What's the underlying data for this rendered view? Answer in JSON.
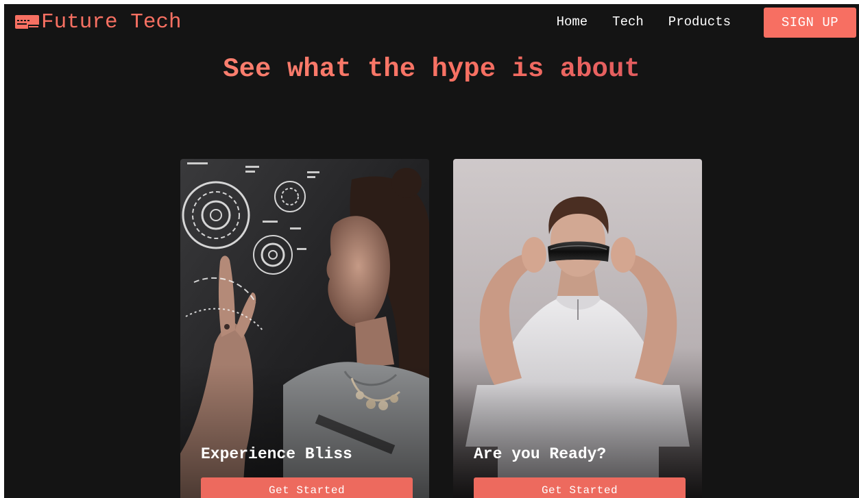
{
  "brand": {
    "name": "Future Tech",
    "icon": "keyboard-icon",
    "accent": "#f77062"
  },
  "nav": {
    "links": [
      "Home",
      "Tech",
      "Products"
    ],
    "signup_label": "SIGN UP"
  },
  "hero": {
    "headline": "See what the hype is about"
  },
  "cards": [
    {
      "title": "Experience Bliss",
      "button_label": "Get Started"
    },
    {
      "title": "Are you Ready?",
      "button_label": "Get Started"
    }
  ],
  "colors": {
    "background": "#141414",
    "accent": "#f76f62",
    "button": "#ed6a5e",
    "gradient_end": "#c6425a"
  }
}
